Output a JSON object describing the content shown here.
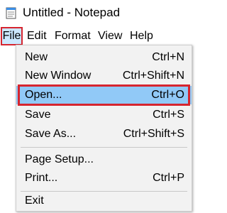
{
  "window": {
    "title": "Untitled - Notepad"
  },
  "menubar": {
    "items": [
      {
        "label": "File"
      },
      {
        "label": "Edit"
      },
      {
        "label": "Format"
      },
      {
        "label": "View"
      },
      {
        "label": "Help"
      }
    ]
  },
  "file_menu": {
    "items": [
      {
        "label": "New",
        "shortcut": "Ctrl+N"
      },
      {
        "label": "New Window",
        "shortcut": "Ctrl+Shift+N"
      },
      {
        "label": "Open...",
        "shortcut": "Ctrl+O"
      },
      {
        "label": "Save",
        "shortcut": "Ctrl+S"
      },
      {
        "label": "Save As...",
        "shortcut": "Ctrl+Shift+S"
      },
      {
        "label": "Page Setup...",
        "shortcut": ""
      },
      {
        "label": "Print...",
        "shortcut": "Ctrl+P"
      },
      {
        "label": "Exit",
        "shortcut": ""
      }
    ]
  },
  "colors": {
    "highlight": "#91c9f7",
    "annotation_red": "#d6252f",
    "menu_background": "#f2f2f2"
  }
}
